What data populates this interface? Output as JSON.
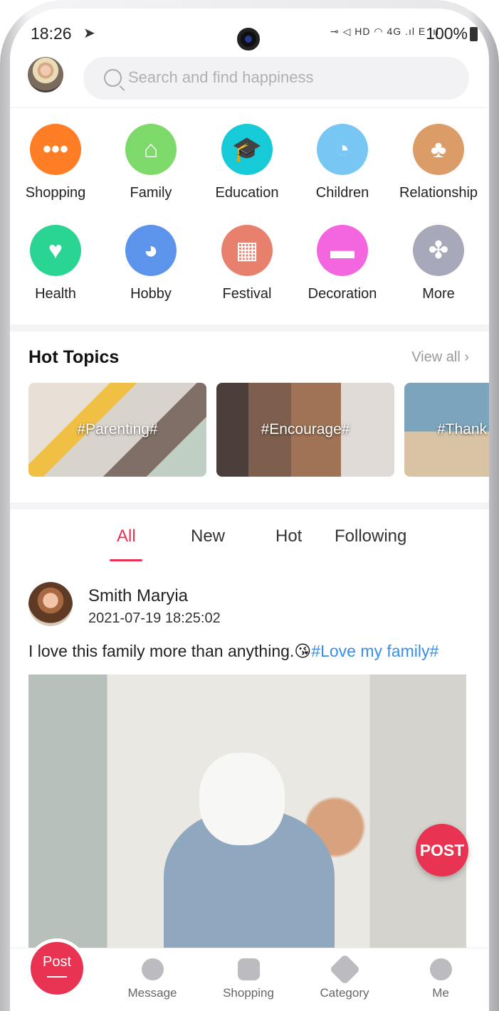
{
  "status_bar": {
    "time": "18:26",
    "battery": "100%",
    "icons": "⊸ ◁ HD ◠ 4G .ıl E .ıl"
  },
  "search": {
    "placeholder": "Search and find happiness"
  },
  "categories": [
    {
      "label": "Shopping",
      "icon": "chat-bubble-icon",
      "color": "#ff7d25",
      "glyph": "•••"
    },
    {
      "label": "Family",
      "icon": "house-icon",
      "color": "#7cd96a",
      "glyph": "⌂"
    },
    {
      "label": "Education",
      "icon": "graduation-cap-icon",
      "color": "#16cad8",
      "glyph": "🎓"
    },
    {
      "label": "Children",
      "icon": "baby-icon",
      "color": "#78c6f3",
      "glyph": "◔"
    },
    {
      "label": "Relationship",
      "icon": "parent-child-icon",
      "color": "#dc9c67",
      "glyph": "♣"
    },
    {
      "label": "Health",
      "icon": "heart-icon",
      "color": "#2ad493",
      "glyph": "♥"
    },
    {
      "label": "Hobby",
      "icon": "pacman-icon",
      "color": "#5b94ea",
      "glyph": "◕"
    },
    {
      "label": "Festival",
      "icon": "gift-icon",
      "color": "#e8806e",
      "glyph": "▦"
    },
    {
      "label": "Decoration",
      "icon": "paint-roller-icon",
      "color": "#f366e0",
      "glyph": "▬"
    },
    {
      "label": "More",
      "icon": "grid-icon",
      "color": "#a7a8b9",
      "glyph": "✤"
    }
  ],
  "hot_topics": {
    "title": "Hot Topics",
    "view_all": "View all",
    "items": [
      "#Parenting#",
      "#Encourage#",
      "#Thank"
    ]
  },
  "tabs": [
    "All",
    "New",
    "Hot",
    "Following"
  ],
  "post": {
    "author": "Smith Maryia",
    "date": "2021-07-19 18:25:02",
    "text": "I love this family more than anything.😘",
    "hashtag": "#Love my family#",
    "float_button": "POST"
  },
  "bottom_nav": {
    "post": "Post",
    "items": [
      "Message",
      "Shopping",
      "Category",
      "Me"
    ]
  }
}
